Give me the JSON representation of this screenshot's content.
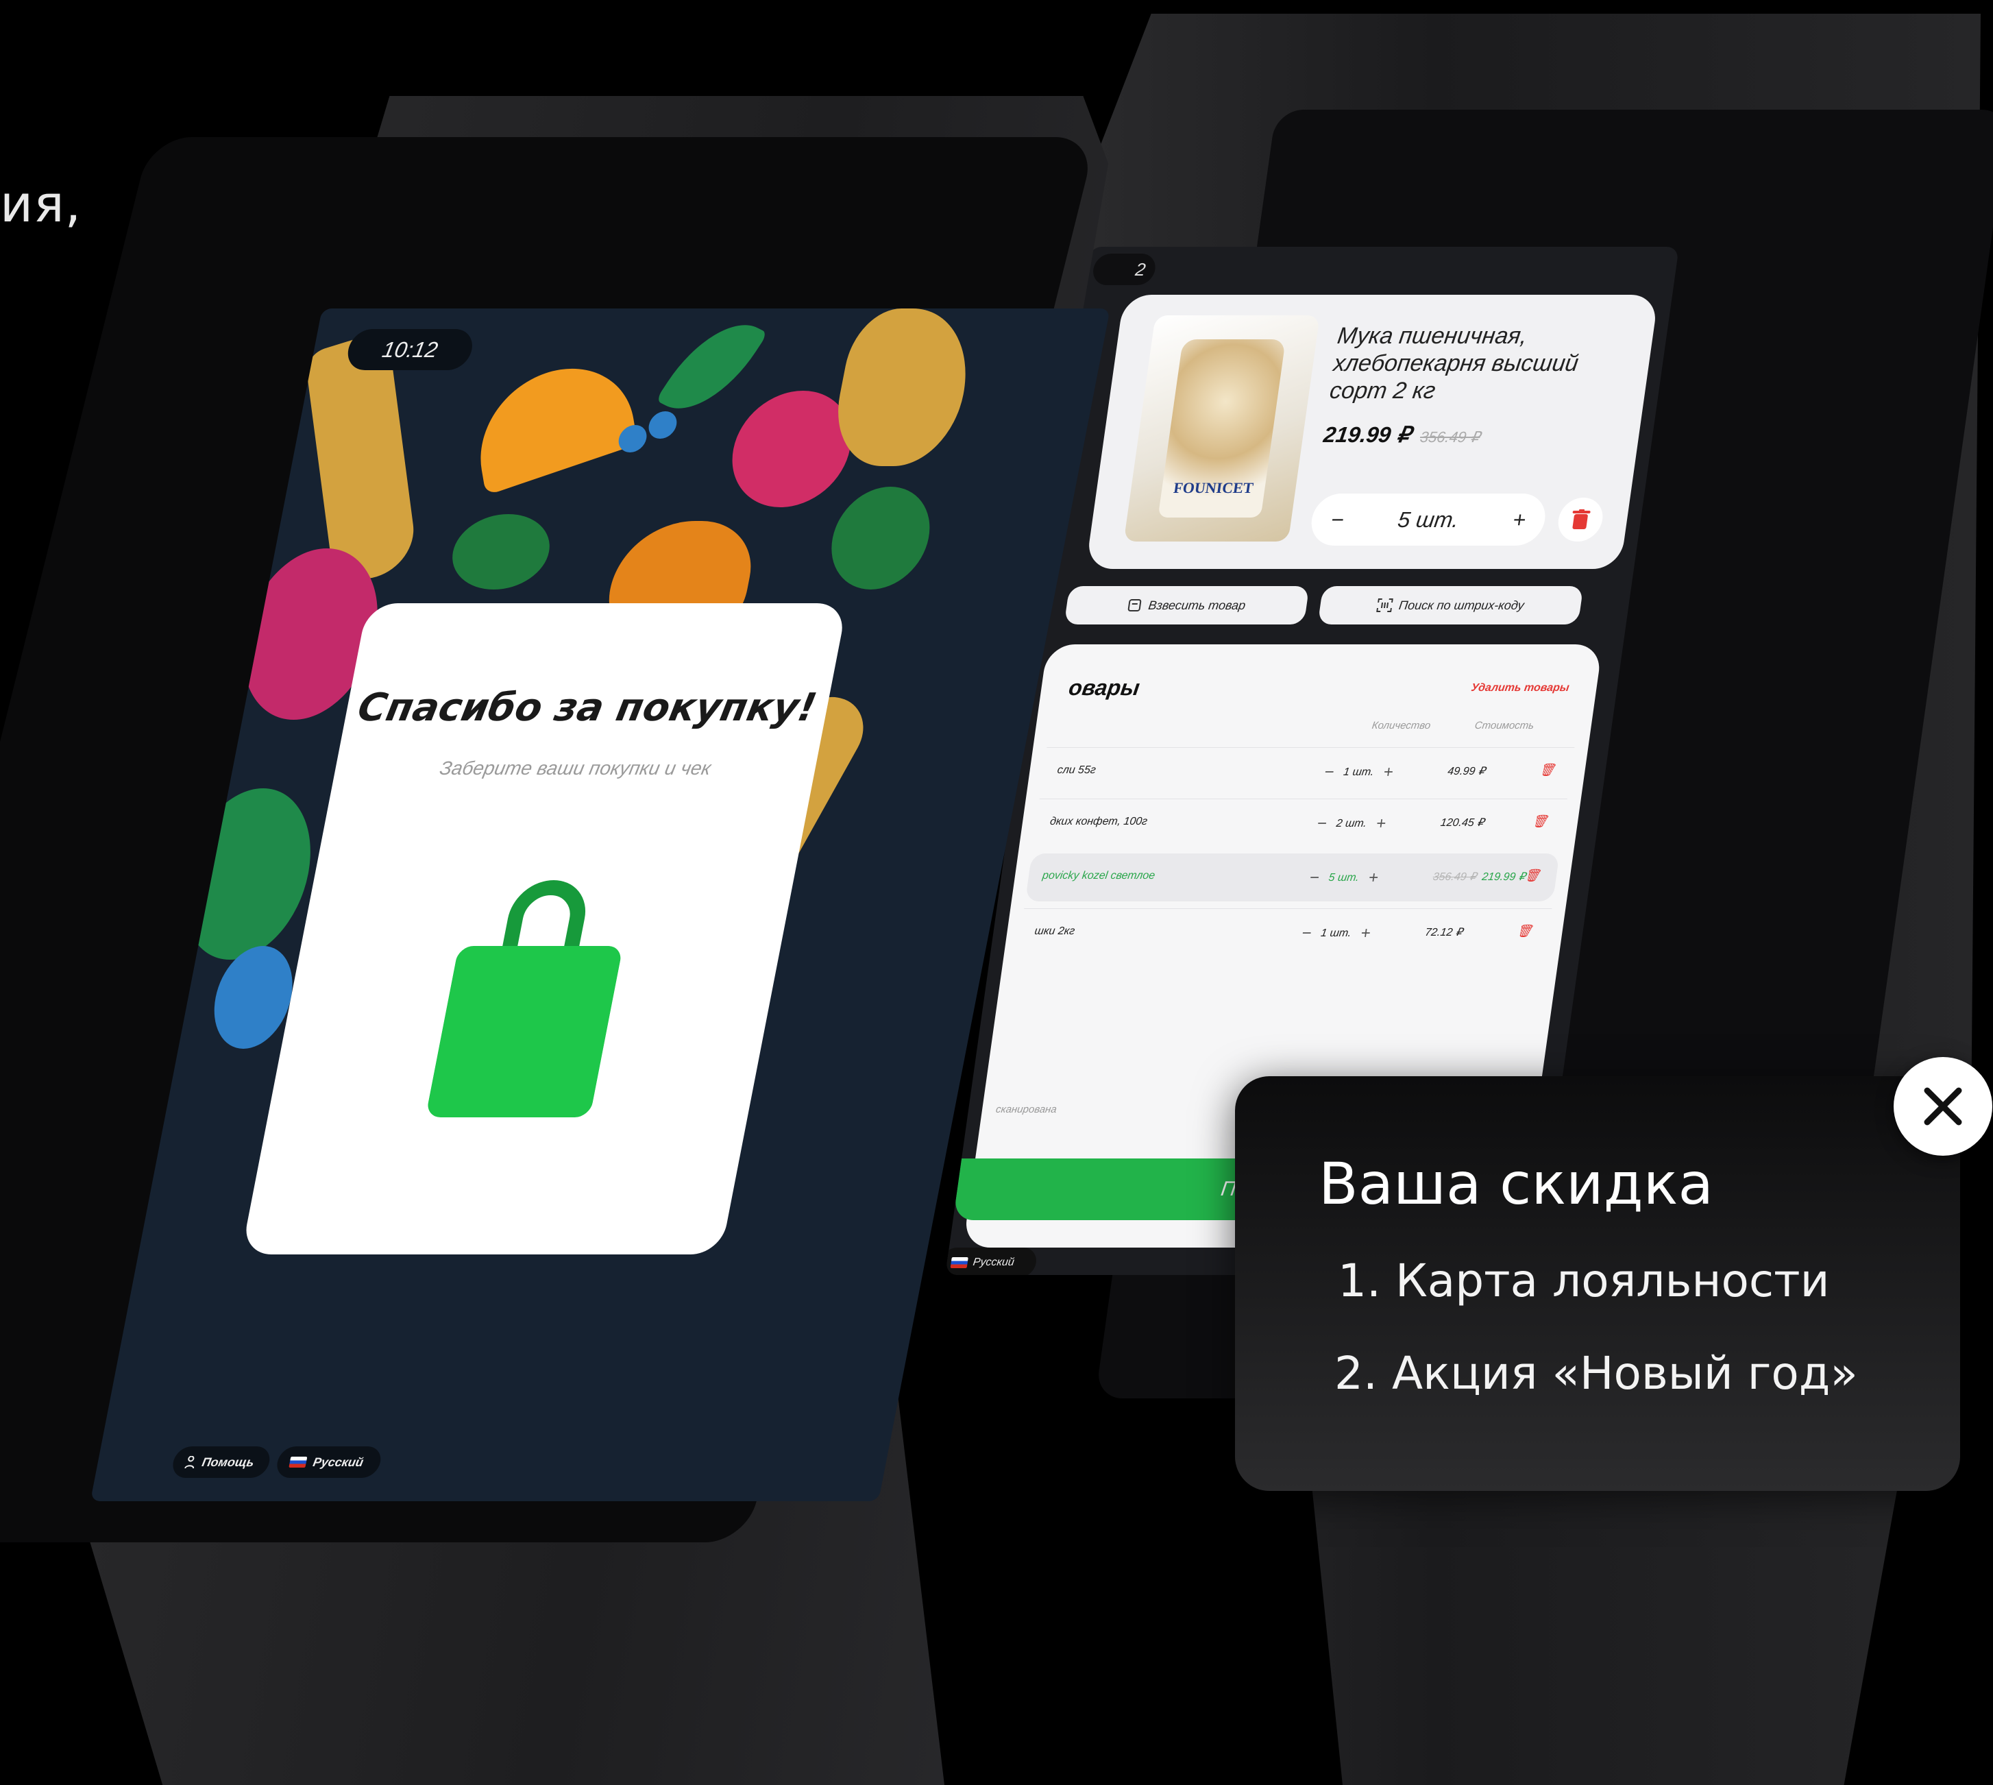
{
  "page": {
    "fragment_text": "ия,"
  },
  "back_kiosk": {
    "time": "2",
    "product": {
      "name": "Мука пшеничная, хлебопекарня высший сорт 2 кг",
      "brand": "FOUNICET",
      "price": "219.99 ₽",
      "old_price": "356.49 ₽",
      "quantity": "5 шт.",
      "minus": "−",
      "plus": "+"
    },
    "actions": {
      "weigh": "Взвесить товар",
      "barcode": "Поиск по штрих-коду"
    },
    "cart": {
      "title": "овары",
      "delete_all": "Удалить товары",
      "col_qty": "Количество",
      "col_cost": "Стоимость",
      "rows": [
        {
          "name": "сли 55г",
          "qty": "1 шт.",
          "old": "",
          "price": "49.99 ₽"
        },
        {
          "name": "дких конфет, 100г",
          "qty": "2 шт.",
          "old": "",
          "price": "120.45 ₽"
        },
        {
          "name": "povicky kozel светлое",
          "qty": "5 шт.",
          "old": "356.49 ₽",
          "price": "219.99 ₽"
        },
        {
          "name": "шки 2кг",
          "qty": "1 шт.",
          "old": "",
          "price": "72.12 ₽"
        }
      ],
      "scan_note": "сканирована"
    },
    "pay_button": "Пер",
    "language": "Русский"
  },
  "front_kiosk": {
    "time": "10:12",
    "thanks_title": "Спасибо за покупку!",
    "thanks_subtitle": "Заберите ваши покупки и чек",
    "help_label": "Помощь",
    "language": "Русский"
  },
  "discount": {
    "title": "Ваша скидка",
    "items": [
      "1. Карта лояльности",
      "2. Акция «Новый год»"
    ]
  },
  "colors": {
    "accent_green": "#22b34a",
    "danger_red": "#e53935",
    "screen_bg": "#162231"
  },
  "icons": [
    "close-icon",
    "trash-icon",
    "scale-icon",
    "barcode-icon",
    "shopping-bag-icon",
    "person-icon",
    "flag-ru-icon"
  ]
}
